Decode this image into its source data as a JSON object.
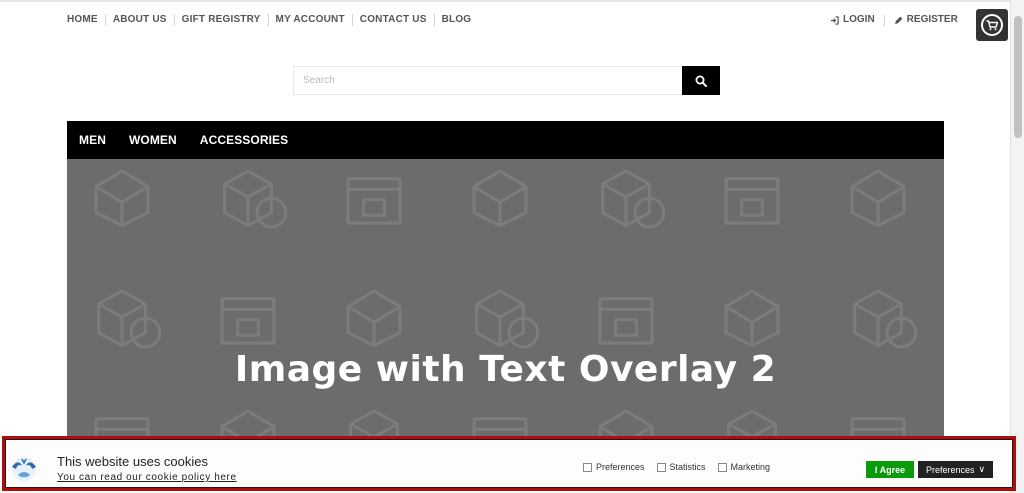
{
  "top_nav": {
    "items": [
      "HOME",
      "ABOUT US",
      "GIFT REGISTRY",
      "MY ACCOUNT",
      "CONTACT US",
      "BLOG"
    ]
  },
  "account": {
    "login_label": "LOGIN",
    "register_label": "REGISTER",
    "login_icon": "sign-in-icon",
    "register_icon": "pencil-icon"
  },
  "cart": {
    "icon": "cart-icon"
  },
  "search": {
    "placeholder": "Search",
    "button_icon": "search-icon"
  },
  "main_nav": {
    "items": [
      "MEN",
      "WOMEN",
      "ACCESSORIES"
    ]
  },
  "hero": {
    "title": "Image with Text Overlay 2",
    "background_color": "#6c6c6c"
  },
  "cookie_banner": {
    "title": "This website uses cookies",
    "policy_link": "You can read our cookie policy here",
    "options": [
      {
        "label": "Preferences",
        "checked": false
      },
      {
        "label": "Statistics",
        "checked": false
      },
      {
        "label": "Marketing",
        "checked": false
      }
    ],
    "agree_label": "I Agree",
    "preferences_label": "Preferences",
    "preferences_chevron": "∨",
    "agree_color": "#0a9b0a",
    "highlight_color": "#b10d0d"
  }
}
